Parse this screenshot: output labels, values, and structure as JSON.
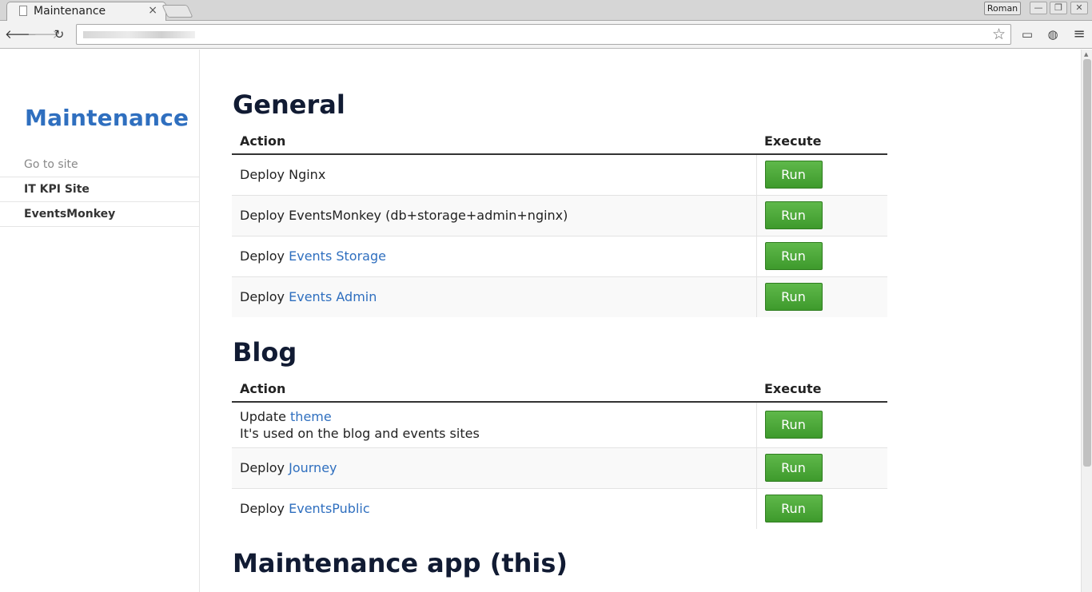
{
  "browser": {
    "tab_title": "Maintenance",
    "tab_close": "×",
    "profile_name": "Roman",
    "back": "🡐",
    "forward": "🡒",
    "reload": "↻",
    "bookmark_star": "☆",
    "cast": "▭",
    "extension": "◍",
    "menu": "≡",
    "minimize": "—",
    "restore": "❐",
    "close_window": "✕"
  },
  "sidebar": {
    "brand": "Maintenance",
    "links": [
      {
        "label": "Go to site"
      },
      {
        "label": "IT KPI Site"
      },
      {
        "label": "EventsMonkey"
      }
    ]
  },
  "sections": [
    {
      "title": "General",
      "col_action": "Action",
      "col_execute": "Execute",
      "rows": [
        {
          "prefix": "Deploy Nginx",
          "link": "",
          "note": "",
          "button": "Run"
        },
        {
          "prefix": "Deploy EventsMonkey (db+storage+admin+nginx)",
          "link": "",
          "note": "",
          "button": "Run"
        },
        {
          "prefix": "Deploy ",
          "link": "Events Storage",
          "note": "",
          "button": "Run"
        },
        {
          "prefix": "Deploy ",
          "link": "Events Admin",
          "note": "",
          "button": "Run"
        }
      ]
    },
    {
      "title": "Blog",
      "col_action": "Action",
      "col_execute": "Execute",
      "rows": [
        {
          "prefix": "Update ",
          "link": "theme",
          "note": "It's used on the blog and events sites",
          "button": "Run"
        },
        {
          "prefix": "Deploy ",
          "link": "Journey",
          "note": "",
          "button": "Run"
        },
        {
          "prefix": "Deploy ",
          "link": "EventsPublic",
          "note": "",
          "button": "Run"
        }
      ]
    },
    {
      "title": "Maintenance app (this)"
    }
  ]
}
